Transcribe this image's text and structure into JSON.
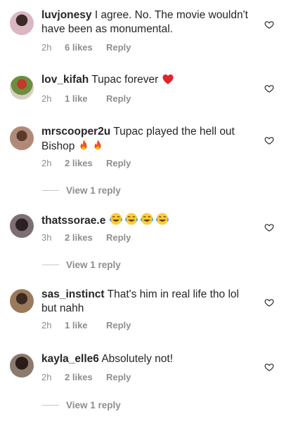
{
  "comments": [
    {
      "username": "luvjonesy",
      "text": "I agree. No. The movie wouldn't have been as monumental.",
      "time": "2h",
      "likes": "6 likes",
      "reply": "Reply"
    },
    {
      "username": "lov_kifah",
      "text": "Tupac forever ",
      "time": "2h",
      "likes": "1 like",
      "reply": "Reply"
    },
    {
      "username": "mrscooper2u",
      "text": "Tupac played the hell out Bishop ",
      "time": "2h",
      "likes": "2 likes",
      "reply": "Reply",
      "view_replies": "View 1 reply"
    },
    {
      "username": "thatssorae.e",
      "text": " ",
      "time": "3h",
      "likes": "2 likes",
      "reply": "Reply",
      "view_replies": "View 1 reply"
    },
    {
      "username": "sas_instinct",
      "text": "That's him in real life tho lol but nahh",
      "time": "2h",
      "likes": "1 like",
      "reply": "Reply"
    },
    {
      "username": "kayla_elle6",
      "text": "Absolutely not!",
      "time": "2h",
      "likes": "2 likes",
      "reply": "Reply",
      "view_replies": "View 1 reply"
    }
  ],
  "icons": {
    "heart_outline": "heart-outline-icon",
    "red_heart": "red-heart-emoji",
    "fire": "fire-emoji",
    "laughing": "tears-of-joy-emoji"
  },
  "colors": {
    "text": "#262626",
    "meta": "#8e8e8e",
    "separator": "#c7c7c7"
  }
}
